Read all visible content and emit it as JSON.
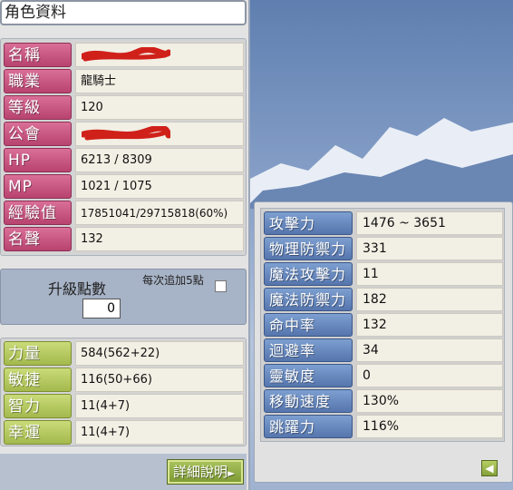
{
  "window": {
    "title": "角色資料"
  },
  "info": [
    {
      "label": "名稱",
      "value": "",
      "redacted": true
    },
    {
      "label": "職業",
      "value": "龍騎士"
    },
    {
      "label": "等級",
      "value": "120"
    },
    {
      "label": "公會",
      "value": "",
      "redacted": true
    },
    {
      "label": "HP",
      "value": "6213 / 8309"
    },
    {
      "label": "MP",
      "value": "1021 / 1075"
    },
    {
      "label": "經驗值",
      "value": "17851041/29715818(60%)"
    },
    {
      "label": "名聲",
      "value": "132"
    }
  ],
  "points": {
    "label": "升級點數",
    "value": "0",
    "auto_add_label": "每次追加5點",
    "auto_add_checked": false
  },
  "stats": [
    {
      "label": "力量",
      "value": "584(562+22)"
    },
    {
      "label": "敏捷",
      "value": "116(50+66)"
    },
    {
      "label": "智力",
      "value": "11(4+7)"
    },
    {
      "label": "幸運",
      "value": "11(4+7)"
    }
  ],
  "detail_button": {
    "label": "詳細說明",
    "icon": "arrow-right-icon"
  },
  "details": [
    {
      "label": "攻擊力",
      "value": "1476 ~ 3651"
    },
    {
      "label": "物理防禦力",
      "value": "331"
    },
    {
      "label": "魔法攻擊力",
      "value": "11"
    },
    {
      "label": "魔法防禦力",
      "value": "182"
    },
    {
      "label": "命中率",
      "value": "132"
    },
    {
      "label": "迴避率",
      "value": "34"
    },
    {
      "label": "靈敏度",
      "value": "0"
    },
    {
      "label": "移動速度",
      "value": "130%"
    },
    {
      "label": "跳躍力",
      "value": "116%"
    }
  ],
  "back_button": {
    "icon": "arrow-left-icon"
  },
  "colors": {
    "info_label": "#c4507c",
    "stat_label": "#b4c95e",
    "detail_label": "#5f80b8",
    "redaction": "#d0201a"
  }
}
